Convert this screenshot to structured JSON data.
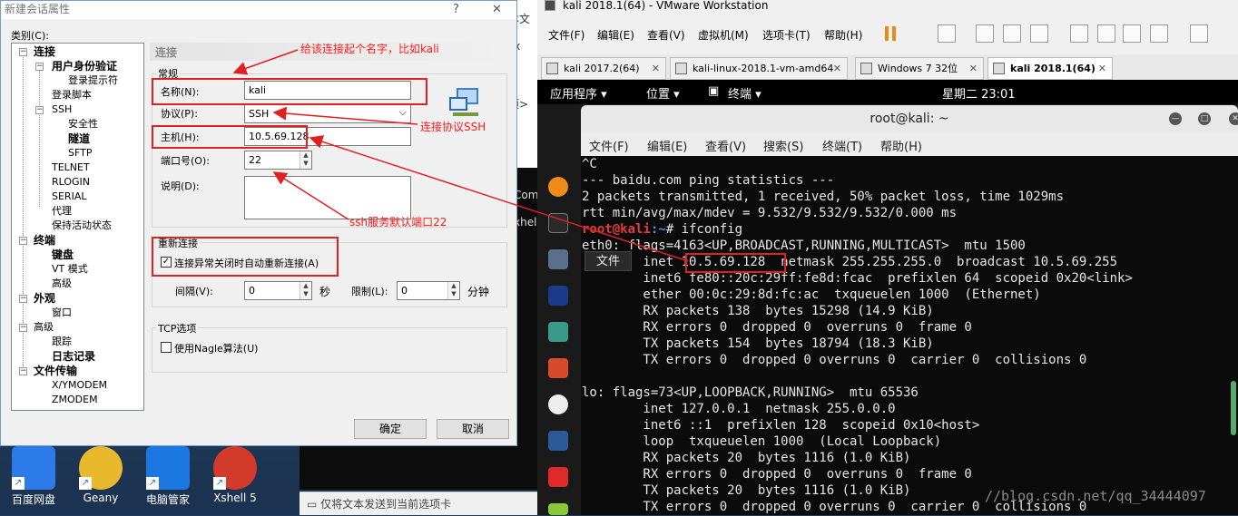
{
  "dialog": {
    "title": "新建会话属性",
    "help": "?",
    "close": "✕",
    "category_label": "类别(C):",
    "section_title": "连接",
    "tree": [
      {
        "label": "连接",
        "bold": true
      },
      {
        "label": "用户身份验证",
        "bold": true
      },
      {
        "label": "登录提示符",
        "bold": false
      },
      {
        "label": "登录脚本",
        "bold": false
      },
      {
        "label": "SSH",
        "bold": false
      },
      {
        "label": "安全性",
        "bold": false
      },
      {
        "label": "隧道",
        "bold": true
      },
      {
        "label": "SFTP",
        "bold": false
      },
      {
        "label": "TELNET",
        "bold": false
      },
      {
        "label": "RLOGIN",
        "bold": false
      },
      {
        "label": "SERIAL",
        "bold": false
      },
      {
        "label": "代理",
        "bold": false
      },
      {
        "label": "保持活动状态",
        "bold": false
      },
      {
        "label": "终端",
        "bold": true
      },
      {
        "label": "键盘",
        "bold": true
      },
      {
        "label": "VT 模式",
        "bold": false
      },
      {
        "label": "高级",
        "bold": false
      },
      {
        "label": "外观",
        "bold": true
      },
      {
        "label": "窗口",
        "bold": false
      },
      {
        "label": "高级",
        "bold": false
      },
      {
        "label": "跟踪",
        "bold": false
      },
      {
        "label": "日志记录",
        "bold": true
      },
      {
        "label": "文件传输",
        "bold": true
      },
      {
        "label": "X/YMODEM",
        "bold": false
      },
      {
        "label": "ZMODEM",
        "bold": false
      }
    ],
    "general_group": "常规",
    "name_label": "名称(N):",
    "name_value": "kali",
    "protocol_label": "协议(P):",
    "protocol_value": "SSH",
    "host_label": "主机(H):",
    "host_value": "10.5.69.128",
    "port_label": "端口号(O):",
    "port_value": "22",
    "desc_label": "说明(D):",
    "reconnect_group": "重新连接",
    "reconnect_check": "连接异常关闭时自动重新连接(A)",
    "interval_label": "间隔(V):",
    "interval_value": "0",
    "seconds_label": "秒",
    "limit_label": "限制(L):",
    "limit_value": "0",
    "minutes_label": "分钟",
    "tcp_group": "TCP选项",
    "nagle_check": "使用Nagle算法(U)",
    "ok_button": "确定",
    "cancel_button": "取消",
    "check_mark": "✓",
    "spin_up": "▲",
    "spin_down": "▼",
    "dropdown_arrow": "⌵"
  },
  "annotations": {
    "name_note": "给该连接起个名字，比如kali",
    "protocol_note": "连接协议SSH",
    "port_note": "ssh服务默认端口22"
  },
  "desktop": {
    "icons": [
      "百度网盘",
      "Geany",
      "电脑管家",
      "Xshell 5"
    ],
    "send_bar": "仅将文本发送到当前选项卡",
    "fragments": [
      "本文",
      "Com",
      "xhel",
      "项>",
      "sx"
    ]
  },
  "vmware": {
    "title": "kali 2018.1(64) - VMware Workstation",
    "menu": [
      "文件(F)",
      "编辑(E)",
      "查看(V)",
      "虚拟机(M)",
      "选项卡(T)",
      "帮助(H)"
    ],
    "tabs": [
      {
        "label": "kali 2017.2(64)",
        "active": false
      },
      {
        "label": "kali-linux-2018.1-vm-amd64",
        "active": false
      },
      {
        "label": "Windows 7 32位",
        "active": false
      },
      {
        "label": "kali 2018.1(64)",
        "active": true
      }
    ],
    "tab_close": "✕"
  },
  "kali": {
    "apps": "应用程序 ▾",
    "places": "位置 ▾",
    "terminal_menu": "终端 ▾",
    "clock": "星期二 23:01",
    "terminal_title": "root@kali: ~",
    "terminal_menu_items": [
      "文件(F)",
      "编辑(E)",
      "查看(V)",
      "搜索(S)",
      "终端(T)",
      "帮助(H)"
    ],
    "prompt_user": "root@kali",
    "prompt_path": ":~",
    "prompt_cmd": "# ifconfig",
    "lines_before": [
      "^C",
      "--- baidu.com ping statistics ---",
      "2 packets transmitted, 1 received, 50% packet loss, time 1029ms",
      "rtt min/avg/max/mdev = 9.532/9.532/9.532/0.000 ms"
    ],
    "lines_after": [
      "eth0: flags=4163<UP,BROADCAST,RUNNING,MULTICAST>  mtu 1500",
      "        inet 10.5.69.128  netmask 255.255.255.0  broadcast 10.5.69.255",
      "        inet6 fe80::20c:29ff:fe8d:fcac  prefixlen 64  scopeid 0x20<link>",
      "        ether 00:0c:29:8d:fc:ac  txqueuelen 1000  (Ethernet)",
      "        RX packets 138  bytes 15298 (14.9 KiB)",
      "        RX errors 0  dropped 0  overruns 0  frame 0",
      "        TX packets 154  bytes 18794 (18.3 KiB)",
      "        TX errors 0  dropped 0 overruns 0  carrier 0  collisions 0",
      "",
      "lo: flags=73<UP,LOOPBACK,RUNNING>  mtu 65536",
      "        inet 127.0.0.1  netmask 255.0.0.0",
      "        inet6 ::1  prefixlen 128  scopeid 0x10<host>",
      "        loop  txqueuelen 1000  (Local Loopback)",
      "        RX packets 20  bytes 1116 (1.0 KiB)",
      "        RX errors 0  dropped 0  overruns 0  frame 0",
      "        TX packets 20  bytes 1116 (1.0 KiB)",
      "        TX errors 0  dropped 0 overruns 0  carrier 0  collisions 0"
    ],
    "file_tooltip": "文件",
    "watermark": "//blog.csdn.net/qq_34444097"
  }
}
